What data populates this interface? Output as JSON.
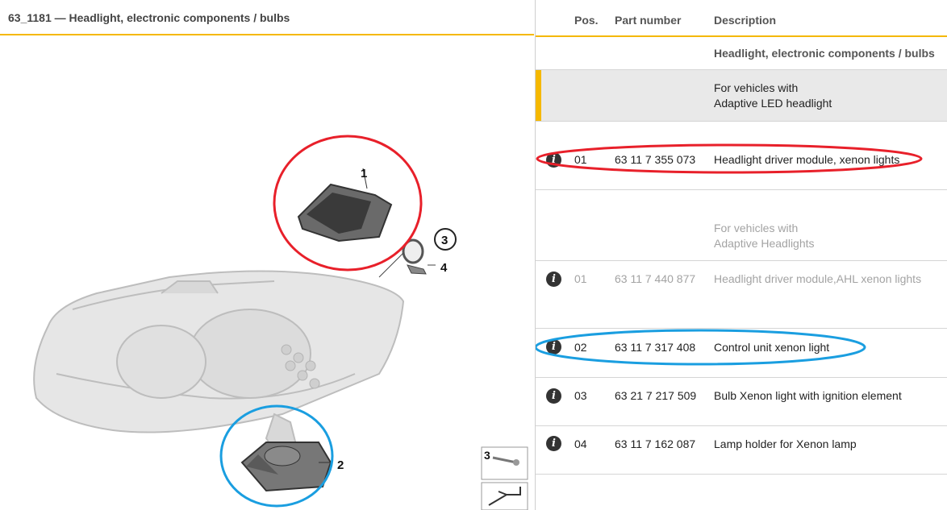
{
  "diagram": {
    "title": "63_1181 — Headlight, electronic components / bulbs",
    "callouts": [
      "1",
      "2",
      "3",
      "4"
    ],
    "thumbnail_label": "3"
  },
  "table": {
    "headers": {
      "pos": "Pos.",
      "part_number": "Part number",
      "description": "Description"
    },
    "section_title": "Headlight, electronic components / bulbs",
    "group1": {
      "line1": "For vehicles with",
      "line2": "Adaptive LED headlight"
    },
    "group2": {
      "line1": "For vehicles with",
      "line2": "Adaptive Headlights"
    },
    "rows": [
      {
        "pos": "01",
        "part": "63 11 7 355 073",
        "desc": "Headlight driver module, xenon lights"
      },
      {
        "pos": "01",
        "part": "63 11 7 440 877",
        "desc": "Headlight driver module,AHL xenon lights"
      },
      {
        "pos": "02",
        "part": "63 11 7 317 408",
        "desc": "Control unit xenon light"
      },
      {
        "pos": "03",
        "part": "63 21 7 217 509",
        "desc": "Bulb Xenon light with ignition element"
      },
      {
        "pos": "04",
        "part": "63 11 7 162 087",
        "desc": "Lamp holder for Xenon lamp"
      }
    ],
    "info_glyph": "i"
  },
  "colors": {
    "accent": "#f5b800",
    "annotation_red": "#e8202a",
    "annotation_blue": "#1a9ee0"
  }
}
